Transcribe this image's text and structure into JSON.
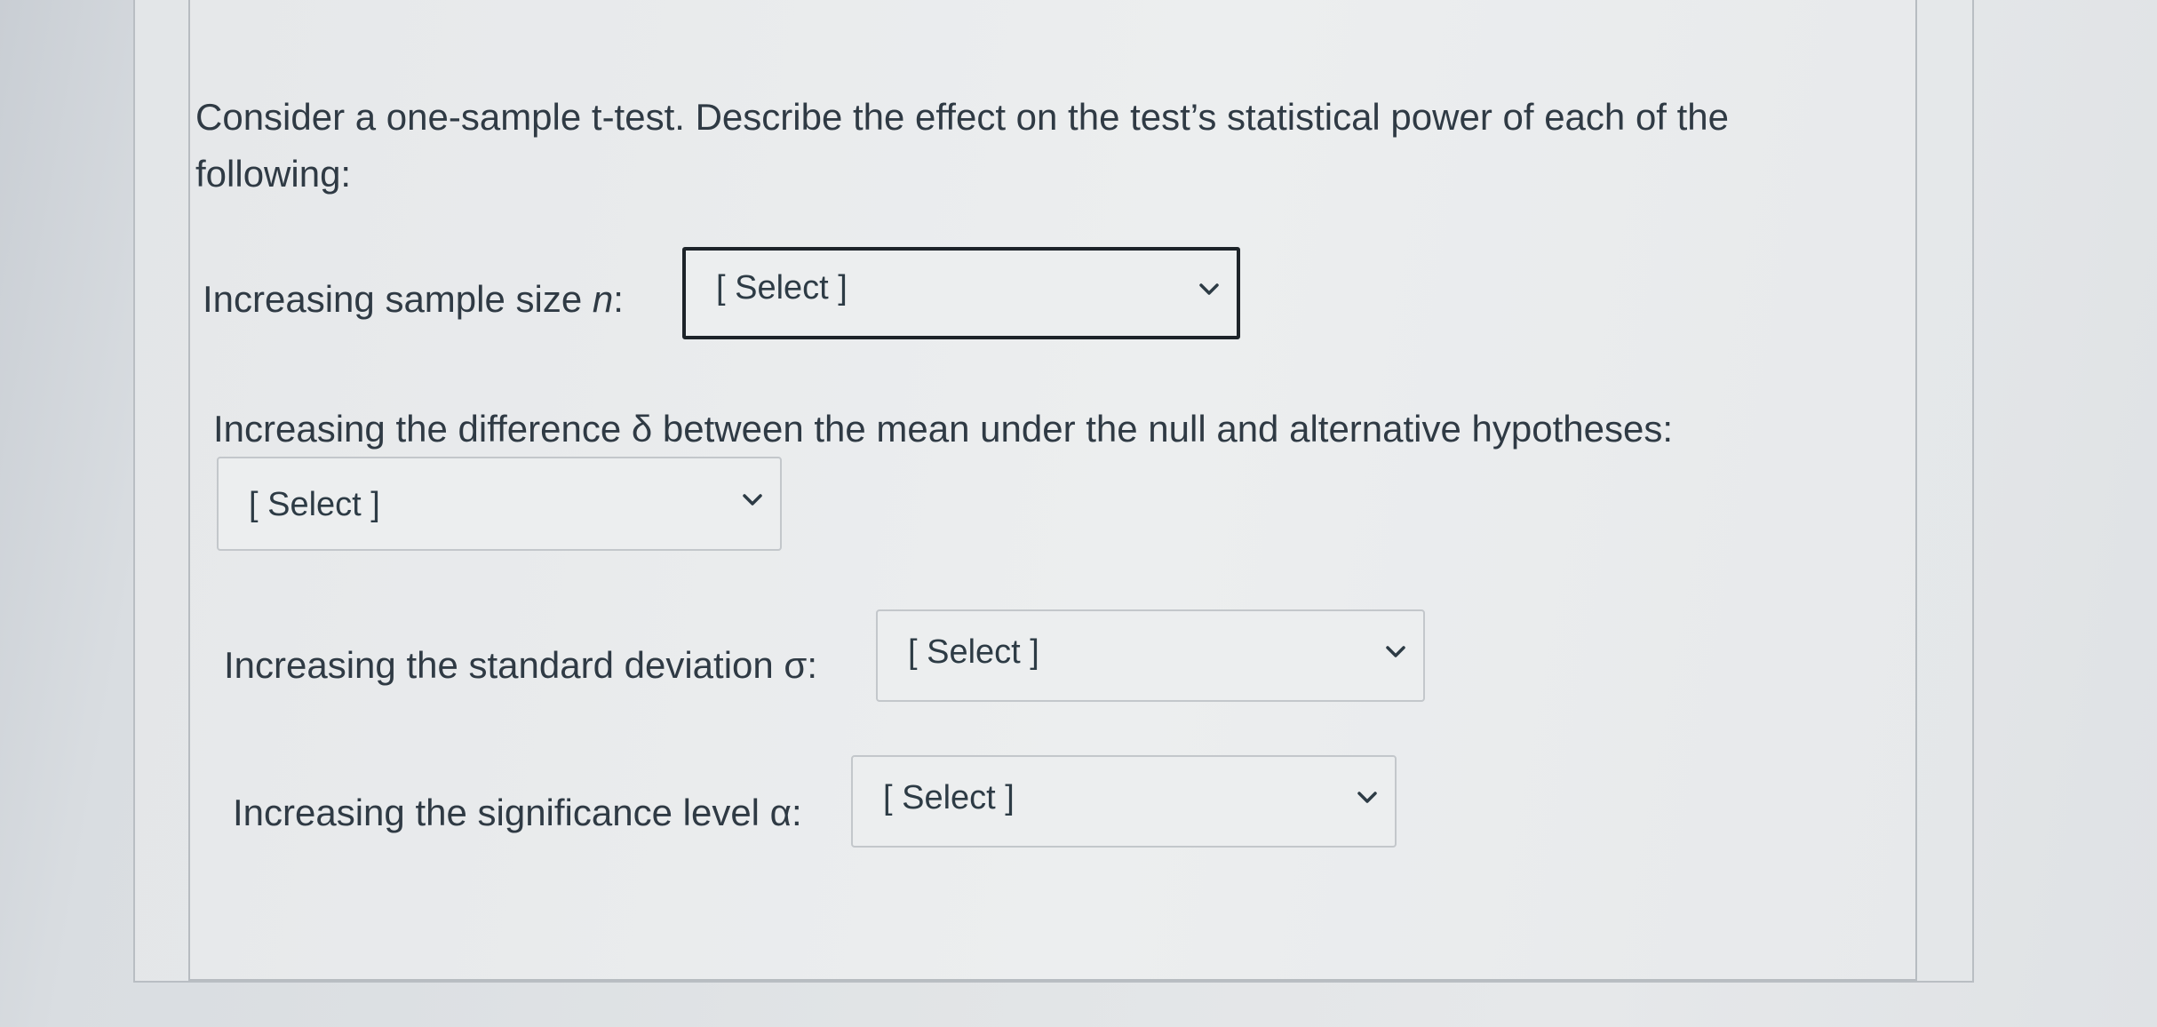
{
  "question": {
    "prompt": "Consider a one-sample t-test. Describe the effect on the test’s statistical power of each of the following:"
  },
  "items": [
    {
      "label_prefix": "Increasing sample size ",
      "label_variable": "n",
      "label_suffix": ":",
      "selected": "[ Select ]"
    },
    {
      "label": "Increasing the difference δ between the mean under the null and alternative hypotheses:",
      "selected": "[ Select ]"
    },
    {
      "label": "Increasing the standard deviation σ:",
      "selected": "[ Select ]"
    },
    {
      "label": "Increasing the significance level α:",
      "selected": "[ Select ]"
    }
  ],
  "icons": {
    "dropdown": "chevron-down-icon"
  },
  "colors": {
    "text": "#2f3a44",
    "border": "#c3c7cb",
    "focus_border": "#1d2329",
    "background": "#eceeef"
  }
}
